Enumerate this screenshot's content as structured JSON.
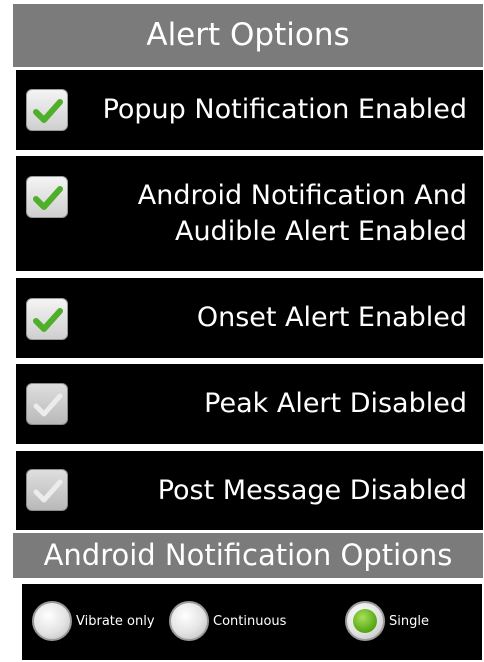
{
  "alert_section": {
    "title": "Alert Options"
  },
  "options": [
    {
      "label": "Popup Notification Enabled",
      "checked": true
    },
    {
      "label": "Android Notification And Audible Alert Enabled",
      "checked": true
    },
    {
      "label": "Onset Alert Enabled",
      "checked": true
    },
    {
      "label": "Peak Alert Disabled",
      "checked": false
    },
    {
      "label": "Post Message Disabled",
      "checked": false
    }
  ],
  "notification_section": {
    "title": "Android Notification Options",
    "radios": [
      {
        "label": "Vibrate only",
        "selected": false
      },
      {
        "label": "Continuous",
        "selected": false
      },
      {
        "label": "Single",
        "selected": true
      }
    ]
  },
  "colors": {
    "header": "#7b7b7b",
    "row": "#000000",
    "check": "#4fae2a"
  }
}
